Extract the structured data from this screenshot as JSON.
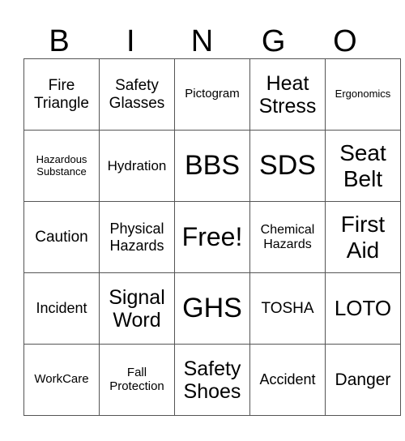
{
  "header": [
    "B",
    "I",
    "N",
    "G",
    "O"
  ],
  "rows": [
    [
      "Fire Triangle",
      "Safety Glasses",
      "Pictogram",
      "Heat Stress",
      "Ergonomics"
    ],
    [
      "Hazardous Substance",
      "Hydration",
      "BBS",
      "SDS",
      "Seat Belt"
    ],
    [
      "Caution",
      "Physical Hazards",
      "Free!",
      "Chemical Hazards",
      "First Aid"
    ],
    [
      "Incident",
      "Signal Word",
      "GHS",
      "TOSHA",
      "LOTO"
    ],
    [
      "WorkCare",
      "Fall Protection",
      "Safety Shoes",
      "Accident",
      "Danger"
    ]
  ]
}
